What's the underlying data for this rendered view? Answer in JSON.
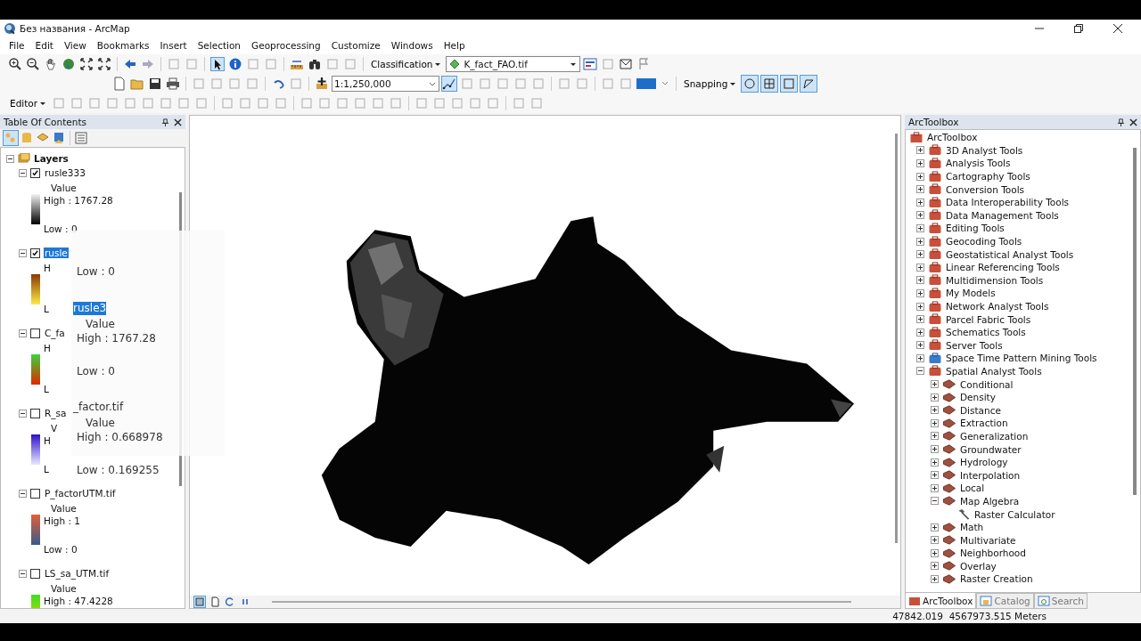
{
  "window": {
    "title": "Без названия - ArcMap"
  },
  "menu": [
    "File",
    "Edit",
    "View",
    "Bookmarks",
    "Insert",
    "Selection",
    "Geoprocessing",
    "Customize",
    "Windows",
    "Help"
  ],
  "toolbars": {
    "classification": "Classification",
    "layer": "K_fact_FAO.tif",
    "scale": "1:1,250,000",
    "editor": "Editor",
    "snapping": "Snapping"
  },
  "snap_modes": [
    {
      "on": true
    },
    {
      "on": true
    },
    {
      "on": true
    },
    {
      "on": true
    }
  ],
  "toc": {
    "title": "Table Of Contents",
    "root": "Layers",
    "layers": [
      {
        "name": "rusle333",
        "checked": true,
        "selected": false,
        "field": "Value",
        "high": "High : 1767.28",
        "low": "Low : 0"
      },
      {
        "name": "rusle",
        "checked": true,
        "selected": true,
        "high": "H",
        "low": "L"
      },
      {
        "name": "C_fa",
        "checked": false,
        "selected": false,
        "high": "H",
        "low": "L"
      },
      {
        "name": "R_sa",
        "checked": false,
        "selected": false,
        "field": "V",
        "high": "H",
        "low": "L"
      },
      {
        "name": "P_factorUTM.tif",
        "checked": false,
        "selected": false,
        "field": "Value",
        "high": "High : 1",
        "low": "Low : 0"
      },
      {
        "name": "LS_sa_UTM.tif",
        "checked": false,
        "selected": false,
        "field": "Value",
        "high": "High : 47.4228"
      }
    ]
  },
  "drag_preview": [
    {
      "kind": "low",
      "text": "Low : 0"
    },
    {
      "kind": "name",
      "text": "rusle3",
      "selected": true
    },
    {
      "kind": "field",
      "text": "Value"
    },
    {
      "kind": "high",
      "text": "High : 1767.28"
    },
    {
      "kind": "low",
      "text": "Low : 0"
    },
    {
      "kind": "name",
      "text": "_factor.tif",
      "selected": false
    },
    {
      "kind": "field",
      "text": "Value"
    },
    {
      "kind": "high",
      "text": "High : 0.668978"
    },
    {
      "kind": "low",
      "text": "Low : 0.169255"
    }
  ],
  "toolbox": {
    "title": "ArcToolbox",
    "root": "ArcToolbox",
    "items": [
      {
        "label": "3D Analyst Tools",
        "kind": "toolbox",
        "expanded": false
      },
      {
        "label": "Analysis Tools",
        "kind": "toolbox",
        "expanded": false
      },
      {
        "label": "Cartography Tools",
        "kind": "toolbox",
        "expanded": false
      },
      {
        "label": "Conversion Tools",
        "kind": "toolbox",
        "expanded": false
      },
      {
        "label": "Data Interoperability Tools",
        "kind": "toolbox",
        "expanded": false
      },
      {
        "label": "Data Management Tools",
        "kind": "toolbox",
        "expanded": false
      },
      {
        "label": "Editing Tools",
        "kind": "toolbox",
        "expanded": false
      },
      {
        "label": "Geocoding Tools",
        "kind": "toolbox",
        "expanded": false
      },
      {
        "label": "Geostatistical Analyst Tools",
        "kind": "toolbox",
        "expanded": false
      },
      {
        "label": "Linear Referencing Tools",
        "kind": "toolbox",
        "expanded": false
      },
      {
        "label": "Multidimension Tools",
        "kind": "toolbox",
        "expanded": false
      },
      {
        "label": "My Models",
        "kind": "toolbox",
        "expanded": false
      },
      {
        "label": "Network Analyst Tools",
        "kind": "toolbox",
        "expanded": false
      },
      {
        "label": "Parcel Fabric Tools",
        "kind": "toolbox",
        "expanded": false
      },
      {
        "label": "Schematics Tools",
        "kind": "toolbox",
        "expanded": false
      },
      {
        "label": "Server Tools",
        "kind": "toolbox",
        "expanded": false
      },
      {
        "label": "Space Time Pattern Mining Tools",
        "kind": "script_toolbox",
        "expanded": false
      },
      {
        "label": "Spatial Analyst Tools",
        "kind": "toolbox",
        "expanded": true,
        "children": [
          {
            "label": "Conditional",
            "kind": "toolset",
            "expanded": false
          },
          {
            "label": "Density",
            "kind": "toolset",
            "expanded": false
          },
          {
            "label": "Distance",
            "kind": "toolset",
            "expanded": false
          },
          {
            "label": "Extraction",
            "kind": "toolset",
            "expanded": false
          },
          {
            "label": "Generalization",
            "kind": "toolset",
            "expanded": false
          },
          {
            "label": "Groundwater",
            "kind": "toolset",
            "expanded": false
          },
          {
            "label": "Hydrology",
            "kind": "toolset",
            "expanded": false
          },
          {
            "label": "Interpolation",
            "kind": "toolset",
            "expanded": false
          },
          {
            "label": "Local",
            "kind": "toolset",
            "expanded": false
          },
          {
            "label": "Map Algebra",
            "kind": "toolset",
            "expanded": true,
            "children": [
              {
                "label": "Raster Calculator",
                "kind": "tool"
              }
            ]
          },
          {
            "label": "Math",
            "kind": "toolset",
            "expanded": false
          },
          {
            "label": "Multivariate",
            "kind": "toolset",
            "expanded": false
          },
          {
            "label": "Neighborhood",
            "kind": "toolset",
            "expanded": false
          },
          {
            "label": "Overlay",
            "kind": "toolset",
            "expanded": false
          },
          {
            "label": "Raster Creation",
            "kind": "toolset",
            "expanded": false
          }
        ]
      }
    ],
    "tabs": [
      {
        "label": "ArcToolbox",
        "selected": true
      },
      {
        "label": "Catalog",
        "selected": false
      },
      {
        "label": "Search",
        "selected": false
      }
    ]
  },
  "status_bar": {
    "coordinates": "47842.019  4567973.515 Meters"
  }
}
